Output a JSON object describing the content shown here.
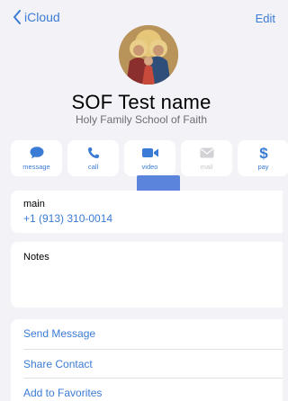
{
  "nav": {
    "back_label": "iCloud",
    "edit_label": "Edit"
  },
  "contact": {
    "name": "SOF Test name",
    "company": "Holy Family School of Faith"
  },
  "actions": [
    {
      "label": "message",
      "icon": "message-bubble-icon",
      "enabled": true
    },
    {
      "label": "call",
      "icon": "phone-icon",
      "enabled": true
    },
    {
      "label": "video",
      "icon": "video-camera-icon",
      "enabled": true
    },
    {
      "label": "mail",
      "icon": "envelope-icon",
      "enabled": false
    },
    {
      "label": "pay",
      "icon": "dollar-icon",
      "enabled": true
    }
  ],
  "phone": {
    "label": "main",
    "value": "+1 (913) 310-0014"
  },
  "notes": {
    "label": "Notes"
  },
  "links": [
    {
      "label": "Send Message"
    },
    {
      "label": "Share Contact"
    },
    {
      "label": "Add to Favorites"
    }
  ],
  "colors": {
    "accent": "#3a7bd5",
    "background": "#f2f2f7",
    "disabled": "#c6c6c8"
  }
}
